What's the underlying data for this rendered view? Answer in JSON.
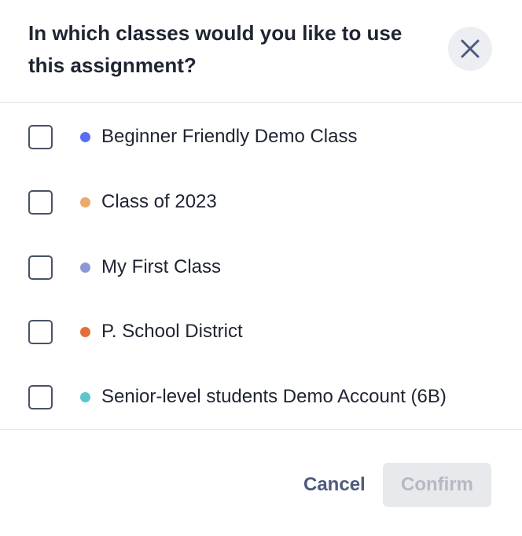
{
  "dialog": {
    "title": "In which classes would you like to use this assignment?",
    "close_icon": "close-icon"
  },
  "classes": [
    {
      "label": "Beginner Friendly Demo Class",
      "color": "#5b6ef0",
      "checked": false
    },
    {
      "label": "Class of 2023",
      "color": "#eda96b",
      "checked": false
    },
    {
      "label": "My First Class",
      "color": "#8e97d4",
      "checked": false
    },
    {
      "label": "P. School District",
      "color": "#e36f36",
      "checked": false
    },
    {
      "label": "Senior-level students Demo Account (6B)",
      "color": "#5cc6cf",
      "checked": false
    }
  ],
  "footer": {
    "cancel_label": "Cancel",
    "confirm_label": "Confirm",
    "confirm_disabled": true
  }
}
